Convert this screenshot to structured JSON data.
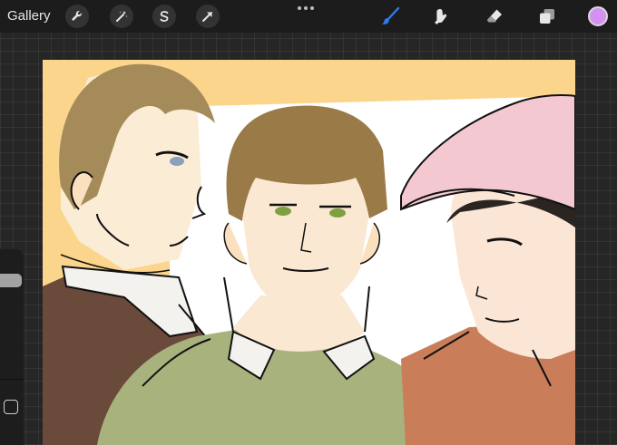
{
  "toolbar": {
    "gallery_label": "Gallery",
    "left_tools": [
      {
        "icon": "wrench-icon",
        "name": "actions"
      },
      {
        "icon": "magic-wand-icon",
        "name": "adjustments"
      },
      {
        "icon": "selection-s-icon",
        "name": "selection"
      },
      {
        "icon": "arrow-cursor-icon",
        "name": "transform"
      }
    ],
    "right_tools": [
      {
        "icon": "brush-icon",
        "name": "paint",
        "active": true
      },
      {
        "icon": "smudge-icon",
        "name": "smudge"
      },
      {
        "icon": "eraser-icon",
        "name": "erase"
      },
      {
        "icon": "layers-icon",
        "name": "layers"
      }
    ],
    "active_color": "#d391f1",
    "accent_color": "#2d7bf0"
  },
  "sidebar": {
    "brush_size_slider": "brush-size",
    "modify_button": "square-icon"
  },
  "canvas": {
    "background_color": "#fbd58c",
    "panel_color": "#ffffff"
  }
}
